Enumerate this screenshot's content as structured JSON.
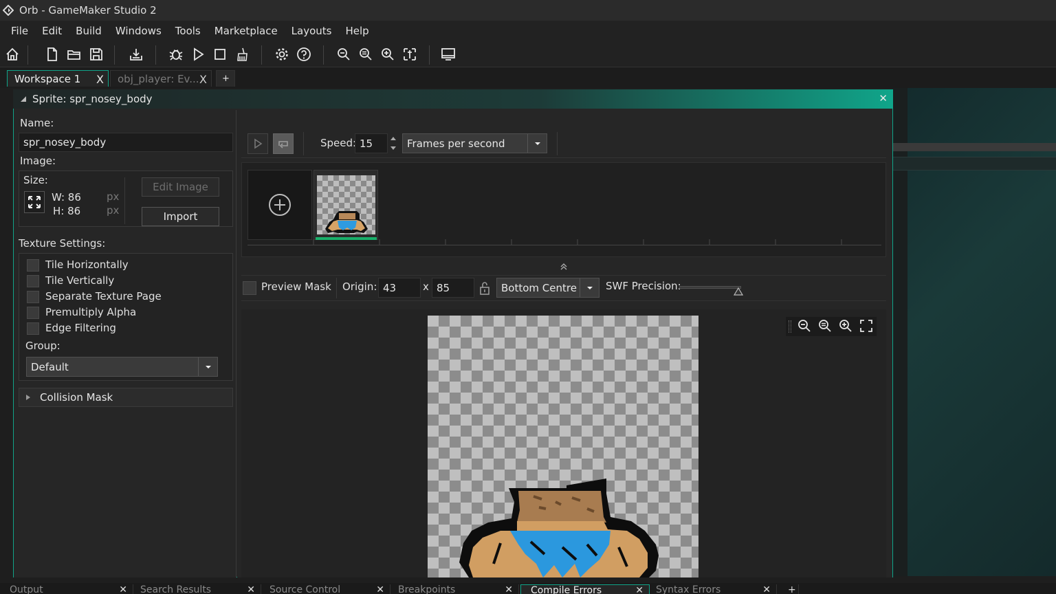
{
  "window": {
    "title": "Orb - GameMaker Studio 2"
  },
  "menu": [
    "File",
    "Edit",
    "Build",
    "Windows",
    "Tools",
    "Marketplace",
    "Layouts",
    "Help"
  ],
  "toolbar": {
    "icons": [
      "home-icon",
      "new-file-icon",
      "open-folder-icon",
      "save-icon",
      "export-icon",
      "debug-icon",
      "play-icon",
      "stop-icon",
      "clean-icon",
      "settings-icon",
      "help-icon",
      "zoom-out-icon",
      "zoom-reset-icon",
      "zoom-in-icon",
      "fit-icon",
      "monitor-icon"
    ]
  },
  "workspace_tabs": [
    {
      "label": "Workspace 1",
      "close": "X"
    },
    {
      "label": "obj_player: Ev...",
      "close": "X"
    },
    {
      "label": "+"
    }
  ],
  "sprite_editor": {
    "title": "Sprite: spr_nosey_body",
    "close": "✕",
    "name_label": "Name:",
    "name_value": "spr_nosey_body",
    "image_label": "Image:",
    "size_label": "Size:",
    "width": "W: 86",
    "height": "H: 86",
    "unit": "px",
    "edit_image": "Edit Image",
    "import": "Import",
    "texture_label": "Texture Settings:",
    "texture_options": [
      "Tile Horizontally",
      "Tile Vertically",
      "Separate Texture Page",
      "Premultiply Alpha",
      "Edge Filtering"
    ],
    "group_label": "Group:",
    "group_value": "Default",
    "collision_mask": "Collision Mask",
    "speed_label": "Speed:",
    "speed_value": "15",
    "speed_unit": "Frames per second",
    "preview_mask": "Preview Mask",
    "origin_label": "Origin:",
    "origin_x": "43",
    "origin_sep": "x",
    "origin_y": "85",
    "origin_preset": "Bottom Centre",
    "swf_label": "SWF Precision:"
  },
  "colors": {
    "accent": "#10a58a",
    "frame_indicator": "#18b06a"
  },
  "bottom_tabs": [
    "Output",
    "Search Results",
    "Source Control",
    "Breakpoints",
    "Compile Errors",
    "Syntax Errors"
  ]
}
